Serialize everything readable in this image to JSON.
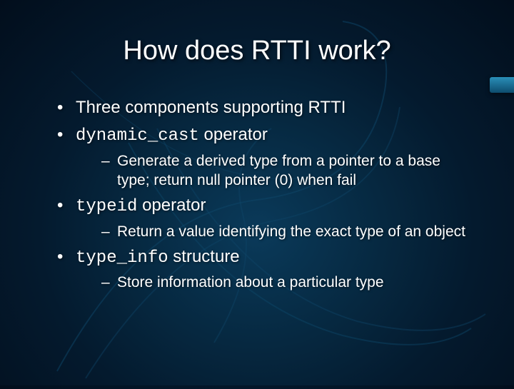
{
  "title": "How does RTTI work?",
  "bullets": [
    {
      "text": "Three components supporting RTTI"
    },
    {
      "code": "dynamic_cast",
      "suffix": " operator",
      "sub": [
        "Generate a derived type from a pointer to a base type; return null pointer (0) when fail"
      ]
    },
    {
      "code": "typeid",
      "suffix": " operator",
      "sub": [
        "Return a value identifying the exact type of an object"
      ]
    },
    {
      "code": "type_info",
      "suffix": " structure",
      "sub": [
        "Store information about a particular type"
      ]
    }
  ]
}
